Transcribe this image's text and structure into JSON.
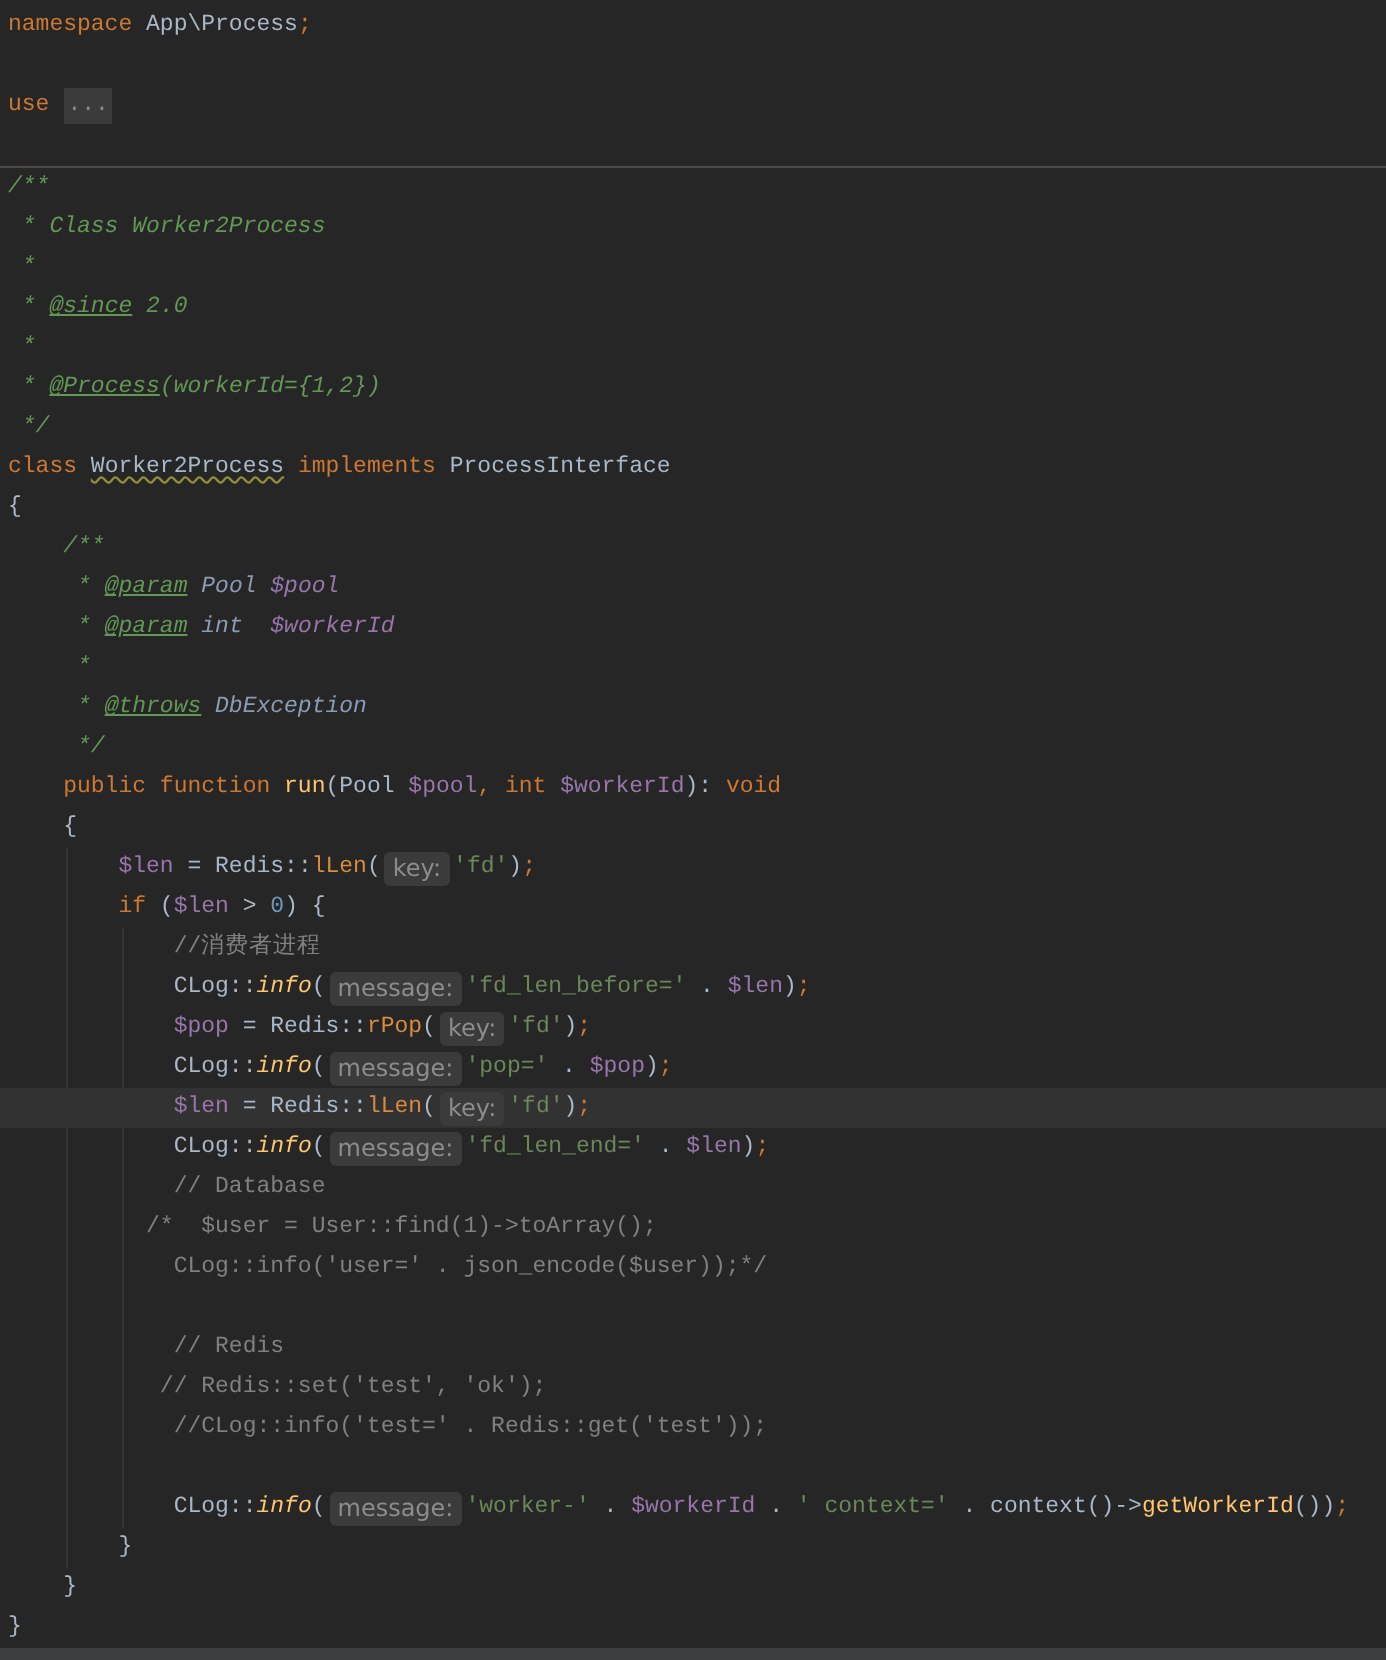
{
  "sections": [
    {
      "lines": [
        {
          "kind": "code",
          "current": false,
          "segments": [
            {
              "kind": "code",
              "tokens": [
                {
                  "kind": "keyword",
                  "text": "namespace"
                },
                {
                  "kind": "plain",
                  "text": " App\\Process"
                },
                {
                  "kind": "punct",
                  "text": ";"
                }
              ]
            }
          ]
        },
        {
          "kind": "blank",
          "current": false
        },
        {
          "kind": "code",
          "current": false,
          "segments": [
            {
              "kind": "code",
              "tokens": [
                {
                  "kind": "keyword",
                  "text": "use"
                }
              ]
            },
            {
              "kind": "fold",
              "text": "..."
            }
          ]
        },
        {
          "kind": "blank",
          "current": false
        }
      ]
    },
    {
      "lines": [
        {
          "kind": "code",
          "current": false,
          "segments": [
            {
              "kind": "code",
              "tokens": [
                {
                  "kind": "doc",
                  "text": "/**"
                }
              ]
            }
          ]
        },
        {
          "kind": "code",
          "current": false,
          "segments": [
            {
              "kind": "code",
              "tokens": [
                {
                  "kind": "doc",
                  "text": " * Class Worker2Process"
                }
              ]
            }
          ]
        },
        {
          "kind": "code",
          "current": false,
          "segments": [
            {
              "kind": "code",
              "tokens": [
                {
                  "kind": "doc",
                  "text": " *"
                }
              ]
            }
          ]
        },
        {
          "kind": "code",
          "current": false,
          "segments": [
            {
              "kind": "code",
              "tokens": [
                {
                  "kind": "doc",
                  "text": " * "
                },
                {
                  "kind": "doc_tag",
                  "text": "@since"
                },
                {
                  "kind": "doc",
                  "text": " 2.0"
                }
              ]
            }
          ]
        },
        {
          "kind": "code",
          "current": false,
          "segments": [
            {
              "kind": "code",
              "tokens": [
                {
                  "kind": "doc",
                  "text": " *"
                }
              ]
            }
          ]
        },
        {
          "kind": "code",
          "current": false,
          "segments": [
            {
              "kind": "code",
              "tokens": [
                {
                  "kind": "doc",
                  "text": " * "
                },
                {
                  "kind": "doc_tag",
                  "text": "@Process"
                },
                {
                  "kind": "doc",
                  "text": "(workerId={1,2})"
                }
              ]
            }
          ]
        },
        {
          "kind": "code",
          "current": false,
          "segments": [
            {
              "kind": "code",
              "tokens": [
                {
                  "kind": "doc",
                  "text": " */"
                }
              ]
            }
          ]
        },
        {
          "kind": "code",
          "current": false,
          "segments": [
            {
              "kind": "code",
              "tokens": [
                {
                  "kind": "keyword",
                  "text": "class "
                },
                {
                  "kind": "typo",
                  "text": "Worker2Process"
                },
                {
                  "kind": "keyword",
                  "text": " implements"
                },
                {
                  "kind": "plain",
                  "text": " ProcessInterface"
                }
              ]
            }
          ]
        },
        {
          "kind": "code",
          "current": false,
          "segments": [
            {
              "kind": "code",
              "tokens": [
                {
                  "kind": "plain",
                  "text": "{"
                }
              ]
            }
          ]
        },
        {
          "kind": "code",
          "current": false,
          "segments": [
            {
              "kind": "code",
              "tokens": [
                {
                  "kind": "doc",
                  "text": "    /**"
                }
              ]
            }
          ]
        },
        {
          "kind": "code",
          "current": false,
          "segments": [
            {
              "kind": "code",
              "tokens": [
                {
                  "kind": "doc",
                  "text": "     * "
                },
                {
                  "kind": "doc_tag",
                  "text": "@param"
                },
                {
                  "kind": "doc_type",
                  "text": " Pool "
                },
                {
                  "kind": "doc_var",
                  "text": "$pool"
                }
              ]
            }
          ]
        },
        {
          "kind": "code",
          "current": false,
          "segments": [
            {
              "kind": "code",
              "tokens": [
                {
                  "kind": "doc",
                  "text": "     * "
                },
                {
                  "kind": "doc_tag",
                  "text": "@param"
                },
                {
                  "kind": "doc_type",
                  "text": " int  "
                },
                {
                  "kind": "doc_var",
                  "text": "$workerId"
                }
              ]
            }
          ]
        },
        {
          "kind": "code",
          "current": false,
          "segments": [
            {
              "kind": "code",
              "tokens": [
                {
                  "kind": "doc",
                  "text": "     *"
                }
              ]
            }
          ]
        },
        {
          "kind": "code",
          "current": false,
          "segments": [
            {
              "kind": "code",
              "tokens": [
                {
                  "kind": "doc",
                  "text": "     * "
                },
                {
                  "kind": "doc_tag",
                  "text": "@throws"
                },
                {
                  "kind": "doc_type",
                  "text": " DbException"
                }
              ]
            }
          ]
        },
        {
          "kind": "code",
          "current": false,
          "segments": [
            {
              "kind": "code",
              "tokens": [
                {
                  "kind": "doc",
                  "text": "     */"
                }
              ]
            }
          ]
        },
        {
          "kind": "code",
          "current": false,
          "segments": [
            {
              "kind": "code",
              "tokens": [
                {
                  "kind": "keyword",
                  "text": "    public function "
                },
                {
                  "kind": "function",
                  "text": "run"
                },
                {
                  "kind": "plain",
                  "text": "(Pool "
                },
                {
                  "kind": "variable",
                  "text": "$pool"
                },
                {
                  "kind": "punct",
                  "text": ", "
                },
                {
                  "kind": "keyword",
                  "text": "int "
                },
                {
                  "kind": "variable",
                  "text": "$workerId"
                },
                {
                  "kind": "plain",
                  "text": "): "
                },
                {
                  "kind": "keyword",
                  "text": "void"
                }
              ]
            }
          ]
        },
        {
          "kind": "code",
          "current": false,
          "segments": [
            {
              "kind": "code",
              "tokens": [
                {
                  "kind": "plain",
                  "text": "    {"
                }
              ]
            }
          ]
        },
        {
          "kind": "code",
          "current": false,
          "segments": [
            {
              "kind": "code",
              "tokens": [
                {
                  "kind": "variable",
                  "text": "        $len"
                },
                {
                  "kind": "plain",
                  "text": " = Redis::"
                },
                {
                  "kind": "static",
                  "text": "lLen"
                },
                {
                  "kind": "plain",
                  "text": "("
                }
              ]
            },
            {
              "kind": "hint",
              "text": "key:"
            },
            {
              "kind": "code",
              "tokens": [
                {
                  "kind": "string",
                  "text": "'fd'"
                },
                {
                  "kind": "plain",
                  "text": ")"
                },
                {
                  "kind": "punct",
                  "text": ";"
                }
              ]
            }
          ]
        },
        {
          "kind": "code",
          "current": false,
          "segments": [
            {
              "kind": "code",
              "tokens": [
                {
                  "kind": "keyword",
                  "text": "        if"
                },
                {
                  "kind": "plain",
                  "text": " ("
                },
                {
                  "kind": "variable",
                  "text": "$len"
                },
                {
                  "kind": "plain",
                  "text": " > "
                },
                {
                  "kind": "number",
                  "text": "0"
                },
                {
                  "kind": "plain",
                  "text": ") {"
                }
              ]
            }
          ]
        },
        {
          "kind": "code",
          "current": false,
          "segments": [
            {
              "kind": "code",
              "tokens": [
                {
                  "kind": "comment",
                  "text": "            //消费者进程"
                }
              ]
            }
          ]
        },
        {
          "kind": "code",
          "current": false,
          "segments": [
            {
              "kind": "code",
              "tokens": [
                {
                  "kind": "plain",
                  "text": "            CLog::"
                },
                {
                  "kind": "static_italic",
                  "text": "info"
                },
                {
                  "kind": "plain",
                  "text": "("
                }
              ]
            },
            {
              "kind": "hint",
              "text": "message:"
            },
            {
              "kind": "code",
              "tokens": [
                {
                  "kind": "string",
                  "text": "'fd_len_before='"
                },
                {
                  "kind": "plain",
                  "text": " . "
                },
                {
                  "kind": "variable",
                  "text": "$len"
                },
                {
                  "kind": "plain",
                  "text": ")"
                },
                {
                  "kind": "punct",
                  "text": ";"
                }
              ]
            }
          ]
        },
        {
          "kind": "code",
          "current": false,
          "segments": [
            {
              "kind": "code",
              "tokens": [
                {
                  "kind": "variable",
                  "text": "            $pop"
                },
                {
                  "kind": "plain",
                  "text": " = Redis::"
                },
                {
                  "kind": "static",
                  "text": "rPop"
                },
                {
                  "kind": "plain",
                  "text": "("
                }
              ]
            },
            {
              "kind": "hint",
              "text": "key:"
            },
            {
              "kind": "code",
              "tokens": [
                {
                  "kind": "string",
                  "text": "'fd'"
                },
                {
                  "kind": "plain",
                  "text": ")"
                },
                {
                  "kind": "punct",
                  "text": ";"
                }
              ]
            }
          ]
        },
        {
          "kind": "code",
          "current": false,
          "segments": [
            {
              "kind": "code",
              "tokens": [
                {
                  "kind": "plain",
                  "text": "            CLog::"
                },
                {
                  "kind": "static_italic",
                  "text": "info"
                },
                {
                  "kind": "plain",
                  "text": "("
                }
              ]
            },
            {
              "kind": "hint",
              "text": "message:"
            },
            {
              "kind": "code",
              "tokens": [
                {
                  "kind": "string",
                  "text": "'pop='"
                },
                {
                  "kind": "plain",
                  "text": " . "
                },
                {
                  "kind": "variable",
                  "text": "$pop"
                },
                {
                  "kind": "plain",
                  "text": ")"
                },
                {
                  "kind": "punct",
                  "text": ";"
                }
              ]
            }
          ]
        },
        {
          "kind": "code",
          "current": true,
          "segments": [
            {
              "kind": "code",
              "tokens": [
                {
                  "kind": "variable",
                  "text": "            $len"
                },
                {
                  "kind": "plain",
                  "text": " = Redis::"
                },
                {
                  "kind": "static",
                  "text": "lLen"
                },
                {
                  "kind": "plain",
                  "text": "("
                }
              ]
            },
            {
              "kind": "hint",
              "text": "key:"
            },
            {
              "kind": "code",
              "tokens": [
                {
                  "kind": "string",
                  "text": "'fd'"
                },
                {
                  "kind": "plain",
                  "text": ")"
                },
                {
                  "kind": "punct",
                  "text": ";"
                }
              ]
            }
          ]
        },
        {
          "kind": "code",
          "current": false,
          "segments": [
            {
              "kind": "code",
              "tokens": [
                {
                  "kind": "plain",
                  "text": "            CLog::"
                },
                {
                  "kind": "static_italic",
                  "text": "info"
                },
                {
                  "kind": "plain",
                  "text": "("
                }
              ]
            },
            {
              "kind": "hint",
              "text": "message:"
            },
            {
              "kind": "code",
              "tokens": [
                {
                  "kind": "string",
                  "text": "'fd_len_end='"
                },
                {
                  "kind": "plain",
                  "text": " . "
                },
                {
                  "kind": "variable",
                  "text": "$len"
                },
                {
                  "kind": "plain",
                  "text": ")"
                },
                {
                  "kind": "punct",
                  "text": ";"
                }
              ]
            }
          ]
        },
        {
          "kind": "code",
          "current": false,
          "segments": [
            {
              "kind": "code",
              "tokens": [
                {
                  "kind": "comment",
                  "text": "            // Database"
                }
              ]
            }
          ]
        },
        {
          "kind": "code",
          "current": false,
          "segments": [
            {
              "kind": "code",
              "tokens": [
                {
                  "kind": "comment",
                  "text": "          /*  $user = User::find(1)->toArray();"
                }
              ]
            }
          ]
        },
        {
          "kind": "code",
          "current": false,
          "segments": [
            {
              "kind": "code",
              "tokens": [
                {
                  "kind": "comment",
                  "text": "            CLog::info('user=' . json_encode($user));*/"
                }
              ]
            }
          ]
        },
        {
          "kind": "blank",
          "current": false
        },
        {
          "kind": "code",
          "current": false,
          "segments": [
            {
              "kind": "code",
              "tokens": [
                {
                  "kind": "comment",
                  "text": "            // Redis"
                }
              ]
            }
          ]
        },
        {
          "kind": "code",
          "current": false,
          "segments": [
            {
              "kind": "code",
              "tokens": [
                {
                  "kind": "comment",
                  "text": "           // Redis::set('test', 'ok');"
                }
              ]
            }
          ]
        },
        {
          "kind": "code",
          "current": false,
          "segments": [
            {
              "kind": "code",
              "tokens": [
                {
                  "kind": "comment",
                  "text": "            //CLog::info('test=' . Redis::get('test'));"
                }
              ]
            }
          ]
        },
        {
          "kind": "blank",
          "current": false
        },
        {
          "kind": "code",
          "current": false,
          "segments": [
            {
              "kind": "code",
              "tokens": [
                {
                  "kind": "plain",
                  "text": "            CLog::"
                },
                {
                  "kind": "static_italic",
                  "text": "info"
                },
                {
                  "kind": "plain",
                  "text": "("
                }
              ]
            },
            {
              "kind": "hint",
              "text": "message:"
            },
            {
              "kind": "code",
              "tokens": [
                {
                  "kind": "string",
                  "text": "'worker-'"
                },
                {
                  "kind": "plain",
                  "text": " . "
                },
                {
                  "kind": "variable",
                  "text": "$workerId"
                },
                {
                  "kind": "plain",
                  "text": " . "
                },
                {
                  "kind": "string",
                  "text": "' context='"
                },
                {
                  "kind": "plain",
                  "text": " . context()->"
                },
                {
                  "kind": "function",
                  "text": "getWorkerId"
                },
                {
                  "kind": "plain",
                  "text": "())"
                },
                {
                  "kind": "punct",
                  "text": ";"
                }
              ]
            }
          ]
        },
        {
          "kind": "code",
          "current": false,
          "segments": [
            {
              "kind": "code",
              "tokens": [
                {
                  "kind": "plain",
                  "text": "        }"
                }
              ]
            }
          ]
        },
        {
          "kind": "code",
          "current": false,
          "segments": [
            {
              "kind": "code",
              "tokens": [
                {
                  "kind": "plain",
                  "text": "    }"
                }
              ]
            }
          ]
        },
        {
          "kind": "code",
          "current": false,
          "segments": [
            {
              "kind": "code",
              "tokens": [
                {
                  "kind": "plain",
                  "text": "}"
                }
              ]
            }
          ]
        }
      ]
    }
  ]
}
